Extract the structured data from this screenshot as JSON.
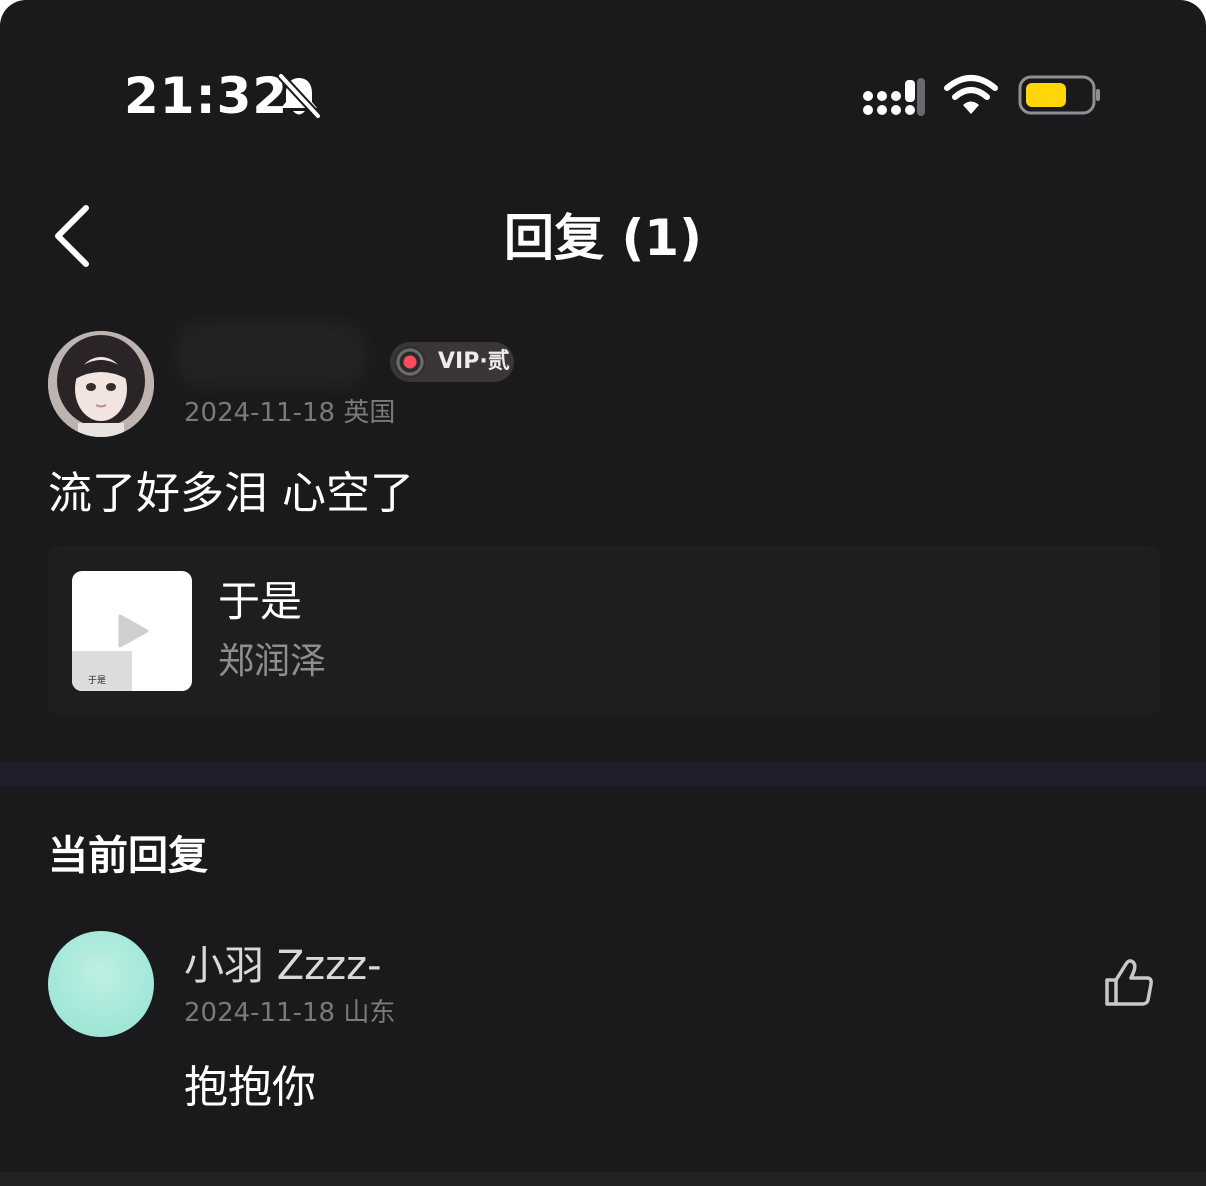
{
  "status_bar": {
    "time": "21:32",
    "icons": [
      "bell-muted-icon",
      "cellular-signal-icon",
      "wifi-icon",
      "battery-icon"
    ],
    "battery_color": "#ffd60a"
  },
  "nav": {
    "title": "回复 (1)",
    "back_icon": "chevron-left-icon"
  },
  "original_comment": {
    "vip_badge": "VIP·贰",
    "date": "2024-11-18",
    "location": "英国",
    "meta": "2024-11-18 英国",
    "text": "流了好多泪 心空了",
    "song": {
      "title": "于是",
      "artist": "郑润泽",
      "cover_caption": "于是"
    }
  },
  "current_reply": {
    "section_title": "当前回复",
    "author": "小羽 Zzzz-",
    "date": "2024-11-18",
    "location": "山东",
    "meta": "2024-11-18 山东",
    "text": "抱抱你",
    "like_icon": "thumbs-up-icon"
  },
  "colors": {
    "background": "#1a1a1c",
    "card": "#1e1e20",
    "secondary_text": "#7a7a7d",
    "divider": "#1e1f2a"
  }
}
